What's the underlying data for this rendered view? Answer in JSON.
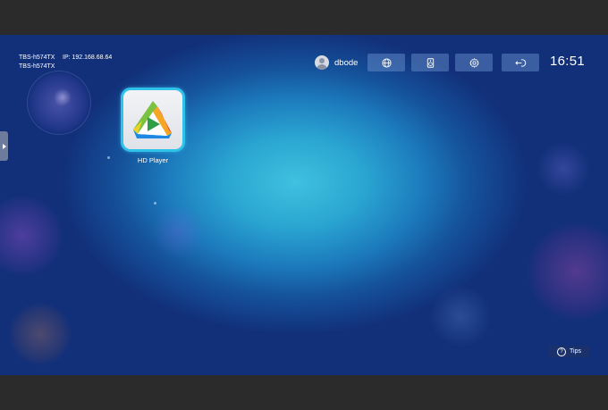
{
  "device": {
    "hostname_line1": "TBS-h574TX",
    "hostname_line2": "TBS-h574TX",
    "ip_label": "IP: 192.168.68.64"
  },
  "user": {
    "name": "dbode"
  },
  "toolbar": {
    "buttons": [
      {
        "icon": "globe-icon"
      },
      {
        "icon": "speaker-icon"
      },
      {
        "icon": "gear-icon"
      },
      {
        "icon": "logout-icon"
      }
    ]
  },
  "clock": {
    "time": "16:51"
  },
  "apps": [
    {
      "label": "HD Player",
      "icon": "hd-player-icon"
    }
  ],
  "tips": {
    "label": "Tips",
    "icon_glyph": "?"
  },
  "colors": {
    "accent": "#2fc3ea",
    "background_center": "#3fc1df",
    "background_edge": "#12307a"
  }
}
